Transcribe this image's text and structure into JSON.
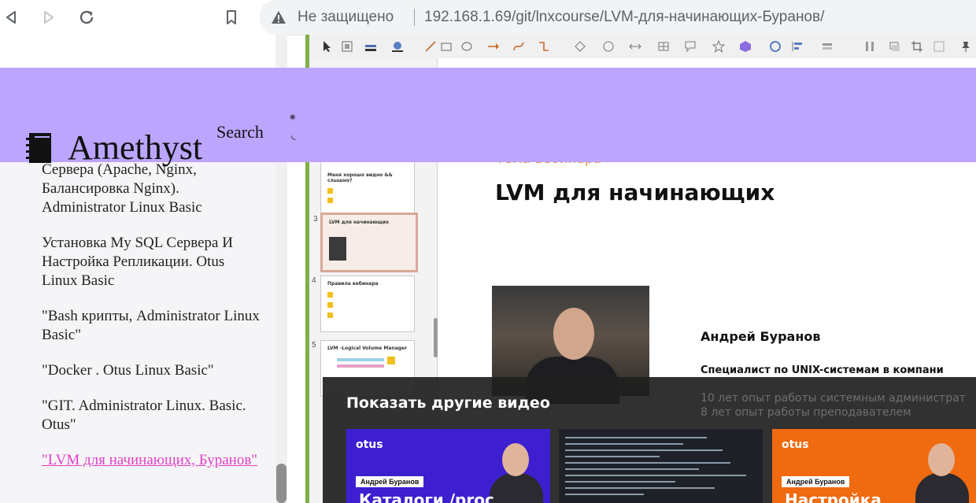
{
  "browser": {
    "security_text": "Не защищено",
    "url": "192.168.1.69/git/lnxcourse/LVM-для-начинающих-Буранов/"
  },
  "header": {
    "brand": "Amethyst",
    "search_label": "Search",
    "banner_color": "#bba5fe"
  },
  "sidebar": {
    "items": [
      {
        "label": "Сервера (Apache, Nginx, Балансировка Nginx). Administrator Linux Basic",
        "active": false
      },
      {
        "label": "Установка My SQL Сервера И Настройка Репликации. Otus Linux Basic",
        "active": false
      },
      {
        "label": "\"Bash крипты, Administrator Linux Basic\"",
        "active": false
      },
      {
        "label": "\"Docker . Otus Linux Basic\"",
        "active": false
      },
      {
        "label": "\"GIT. Administrator Linux. Basic. Otus\"",
        "active": false
      },
      {
        "label": "\"LVM для начинающих, Буранов\"",
        "active": true
      }
    ],
    "active_color": "#e040c8"
  },
  "video": {
    "thumbnails": [
      {
        "num": "",
        "title": "Меня хорошо видно && слышно?"
      },
      {
        "num": "3",
        "title": "LVM для начинающих"
      },
      {
        "num": "4",
        "title": "Правила вебинара"
      },
      {
        "num": "5",
        "title": "LVM -Logical Volume Manager"
      }
    ],
    "slide": {
      "subtitle": "Тема вебинара",
      "title": "LVM для начинающих",
      "presenter_name": "Андрей Буранов",
      "presenter_role": "Специалист по UNIX-системам в компани"
    },
    "more_videos": {
      "title": "Показать другие видео",
      "experience_line_1": "10 лет опыт работы системным администрат",
      "experience_line_2": "8 лет опыт работы преподавателем",
      "cards": [
        {
          "logo": "otus",
          "badge": "Андрей Буранов",
          "caption": "Каталоги /proc",
          "bg": "#3e1fd0"
        },
        {
          "logo": "",
          "badge": "",
          "caption": "",
          "bg": "#1e2228"
        },
        {
          "logo": "otus",
          "badge": "Андрей Буранов",
          "caption": "Настройка",
          "bg": "#f06a10"
        }
      ]
    }
  }
}
